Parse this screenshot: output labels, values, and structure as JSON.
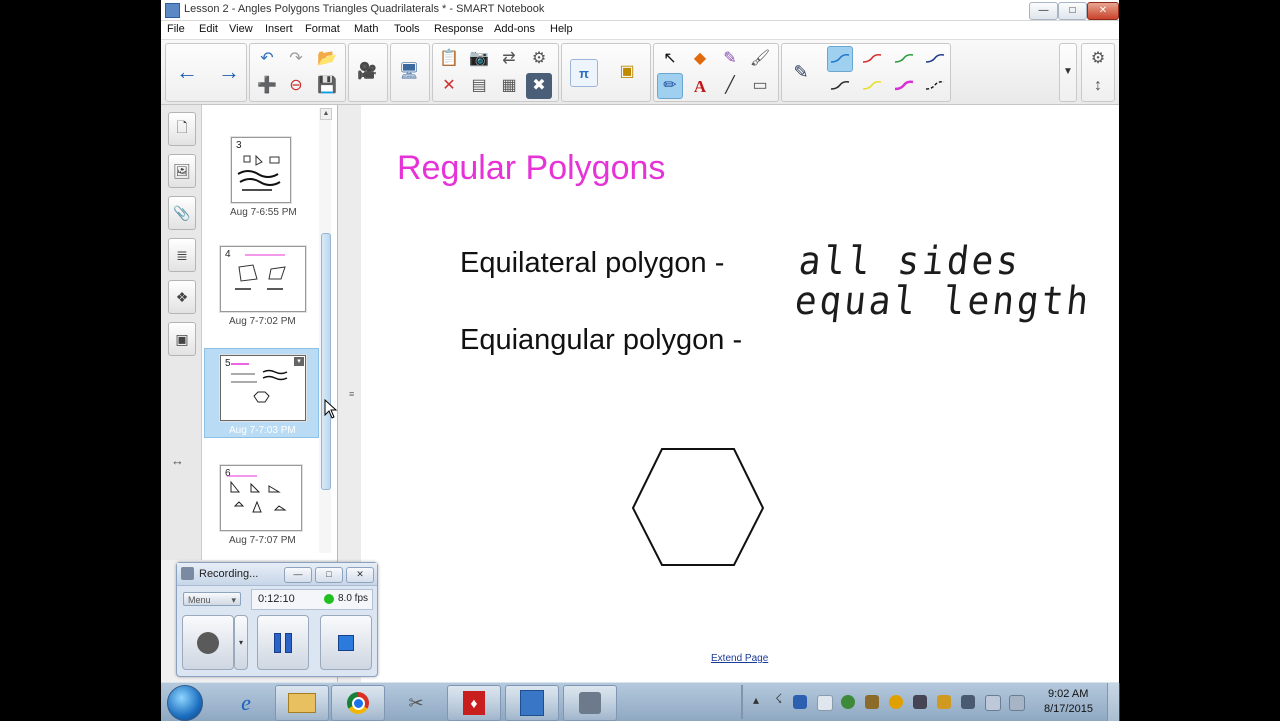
{
  "window": {
    "title": "Lesson 2 - Angles Polygons Triangles Quadrilaterals * - SMART Notebook",
    "min_glyph": "—",
    "max_glyph": "□",
    "close_glyph": "✕"
  },
  "menu": [
    "File",
    "Edit",
    "View",
    "Insert",
    "Format",
    "Math",
    "Tools",
    "Response",
    "Add-ons",
    "Help"
  ],
  "toolbar": {
    "pen_colors": [
      "#1f78c8",
      "#d42a2a",
      "#2a9a3a",
      "#1f3a8c",
      "#2a2a2a",
      "#e8e020",
      "#d830d8",
      "#1a1a1a"
    ]
  },
  "sorter": {
    "pages": [
      {
        "num": "3",
        "date": "Aug 7-6:55 PM"
      },
      {
        "num": "4",
        "date": "Aug 7-7:02 PM"
      },
      {
        "num": "5",
        "date": "Aug 7-7:03 PM"
      },
      {
        "num": "6",
        "date": "Aug 7-7:07 PM"
      }
    ]
  },
  "slide": {
    "title": "Regular Polygons",
    "line1": "Equilateral polygon -",
    "line2": "Equiangular polygon -",
    "handwriting1": "all sides",
    "handwriting2": "equal length",
    "extend_link": "Extend Page",
    "title_color": "#e633d8"
  },
  "recorder": {
    "title": "Recording...",
    "menu_label": "Menu",
    "time": "0:12:10",
    "fps": "8.0 fps"
  },
  "taskbar": {
    "time": "9:02 AM",
    "date": "8/17/2015"
  }
}
